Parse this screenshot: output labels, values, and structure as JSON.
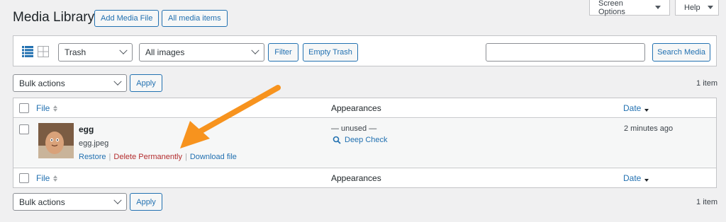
{
  "page": {
    "title": "Media Library"
  },
  "header_buttons": {
    "add_media": "Add Media File",
    "all_media": "All media items"
  },
  "top_tabs": {
    "screen_options": "Screen Options",
    "help": "Help"
  },
  "toolbar": {
    "status_select": "Trash",
    "type_select": "All images",
    "filter_button": "Filter",
    "empty_trash_button": "Empty Trash",
    "search_value": "",
    "search_button": "Search Media"
  },
  "bulk_top": {
    "select": "Bulk actions",
    "apply": "Apply",
    "count": "1 item"
  },
  "bulk_bottom": {
    "select": "Bulk actions",
    "apply": "Apply",
    "count": "1 item"
  },
  "columns": {
    "file": "File",
    "appearances": "Appearances",
    "date": "Date"
  },
  "rows": [
    {
      "title": "egg",
      "filename": "egg.jpeg",
      "appearances": "— unused —",
      "deep_check": "Deep Check",
      "date": "2 minutes ago",
      "actions": {
        "restore": "Restore",
        "delete": "Delete Permanently",
        "download": "Download file"
      }
    }
  ],
  "colors": {
    "accent": "#2271b1",
    "danger": "#b32d2e",
    "annotation_arrow": "#f7931e"
  },
  "icons": [
    "list-view-icon",
    "grid-view-icon",
    "search-icon",
    "sort-icon",
    "chevron-down-icon"
  ]
}
